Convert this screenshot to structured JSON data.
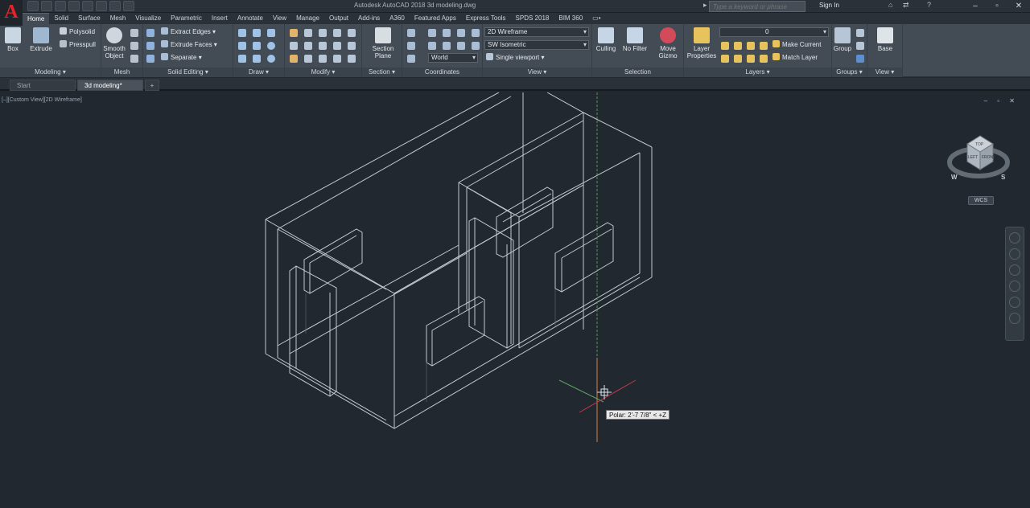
{
  "app": {
    "logo": "A",
    "title": "Autodesk AutoCAD 2018   3d modeling.dwg",
    "search_placeholder": "Type a keyword or phrase",
    "sign_in": "Sign In"
  },
  "ribbon_tabs": [
    "Home",
    "Solid",
    "Surface",
    "Mesh",
    "Visualize",
    "Parametric",
    "Insert",
    "Annotate",
    "View",
    "Manage",
    "Output",
    "Add-ins",
    "A360",
    "Featured Apps",
    "Express Tools",
    "SPDS 2018",
    "BIM 360",
    "▭•"
  ],
  "panels": {
    "modeling": {
      "label": "Modeling ▾",
      "box": "Box",
      "extrude": "Extrude",
      "polysolid": "Polysolid",
      "presspull": "Presspull"
    },
    "mesh": {
      "label": "Mesh",
      "smooth_object": "Smooth Object"
    },
    "solid_editing": {
      "label": "Solid Editing ▾",
      "extract_edges": "Extract Edges",
      "extrude_faces": "Extrude Faces",
      "separate": "Separate"
    },
    "draw": {
      "label": "Draw ▾"
    },
    "modify": {
      "label": "Modify ▾"
    },
    "section": {
      "label": "Section ▾",
      "section_plane": "Section Plane"
    },
    "coordinates": {
      "label": "Coordinates",
      "ucs_value": "World"
    },
    "view": {
      "label": "View ▾",
      "visual_style": "2D Wireframe",
      "view_direction": "SW Isometric",
      "viewport": "Single viewport"
    },
    "selection": {
      "label": "Selection",
      "culling": "Culling",
      "no_filter": "No Filter",
      "move_gizmo": "Move Gizmo"
    },
    "layers": {
      "label": "Layers ▾",
      "layer_properties": "Layer Properties",
      "current_layer": "0",
      "make_current": "Make Current",
      "match_layer": "Match Layer"
    },
    "groups": {
      "label": "Groups ▾",
      "group": "Group"
    },
    "view2": {
      "label": "View ▾",
      "base": "Base"
    }
  },
  "doc_tabs": [
    {
      "label": "Start"
    },
    {
      "label": "3d modeling*"
    }
  ],
  "viewport": {
    "label": "[–][Custom View][2D Wireframe]",
    "controls": "– ▫ ✕",
    "tooltip": "Polar: 2'-7 7/8\" < +Z",
    "viewcube": {
      "top": "TOP",
      "left": "LEFT",
      "front": "FRONT",
      "compass_w": "W",
      "compass_s": "S"
    },
    "wcs": "WCS"
  },
  "colors": {
    "ribbon_bg": "#434b54",
    "viewport_bg": "#212830",
    "model_lines": "#d2d7dc"
  }
}
